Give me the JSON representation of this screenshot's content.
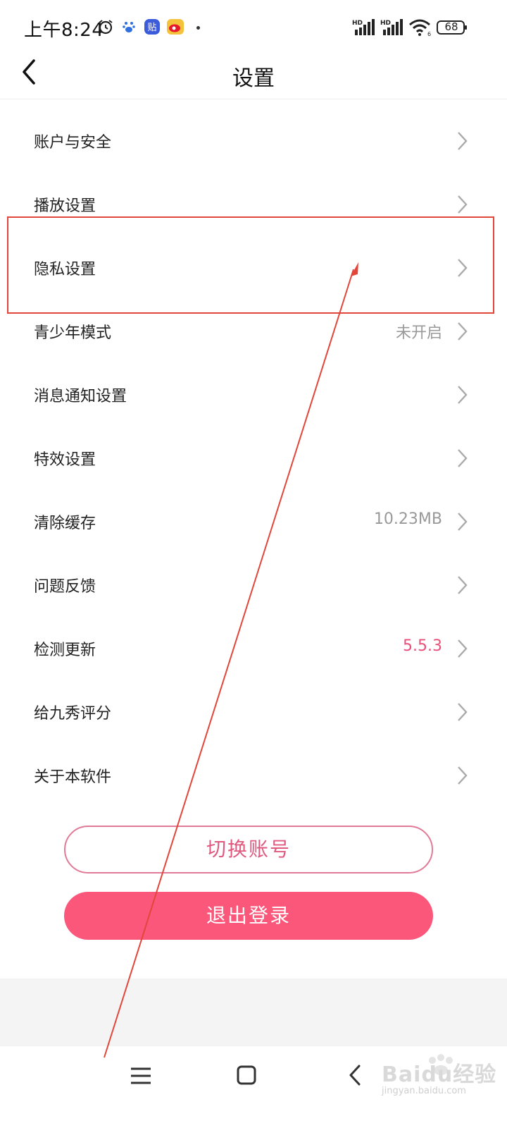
{
  "status_bar": {
    "time": "上午8:24",
    "battery": "68",
    "icons": [
      "alarm-icon",
      "baidu-paw-icon",
      "tieba-icon",
      "weibo-icon",
      "signal-hd-icon",
      "signal-hd-icon",
      "wifi-icon",
      "battery-icon"
    ]
  },
  "header": {
    "title": "设置",
    "back_icon": "chevron-left-icon"
  },
  "settings": {
    "items": [
      {
        "label": "账户与安全",
        "value": ""
      },
      {
        "label": "播放设置",
        "value": ""
      },
      {
        "label": "隐私设置",
        "value": ""
      },
      {
        "label": "青少年模式",
        "value": "未开启"
      },
      {
        "label": "消息通知设置",
        "value": ""
      },
      {
        "label": "特效设置",
        "value": ""
      },
      {
        "label": "清除缓存",
        "value": "10.23MB"
      },
      {
        "label": "问题反馈",
        "value": ""
      },
      {
        "label": "检测更新",
        "value": "5.5.3"
      },
      {
        "label": "给九秀评分",
        "value": ""
      },
      {
        "label": "关于本软件",
        "value": ""
      }
    ]
  },
  "actions": {
    "switch_account": "切换账号",
    "logout": "退出登录"
  },
  "nav_bar": {
    "icons": [
      "menu-icon",
      "home-icon",
      "back-icon"
    ]
  },
  "watermark": {
    "text": "Baidu经验",
    "url": "jingyan.baidu.com"
  },
  "colors": {
    "accent": "#fa577a",
    "accent_text": "#e8507a",
    "annotation": "#e2463a"
  }
}
